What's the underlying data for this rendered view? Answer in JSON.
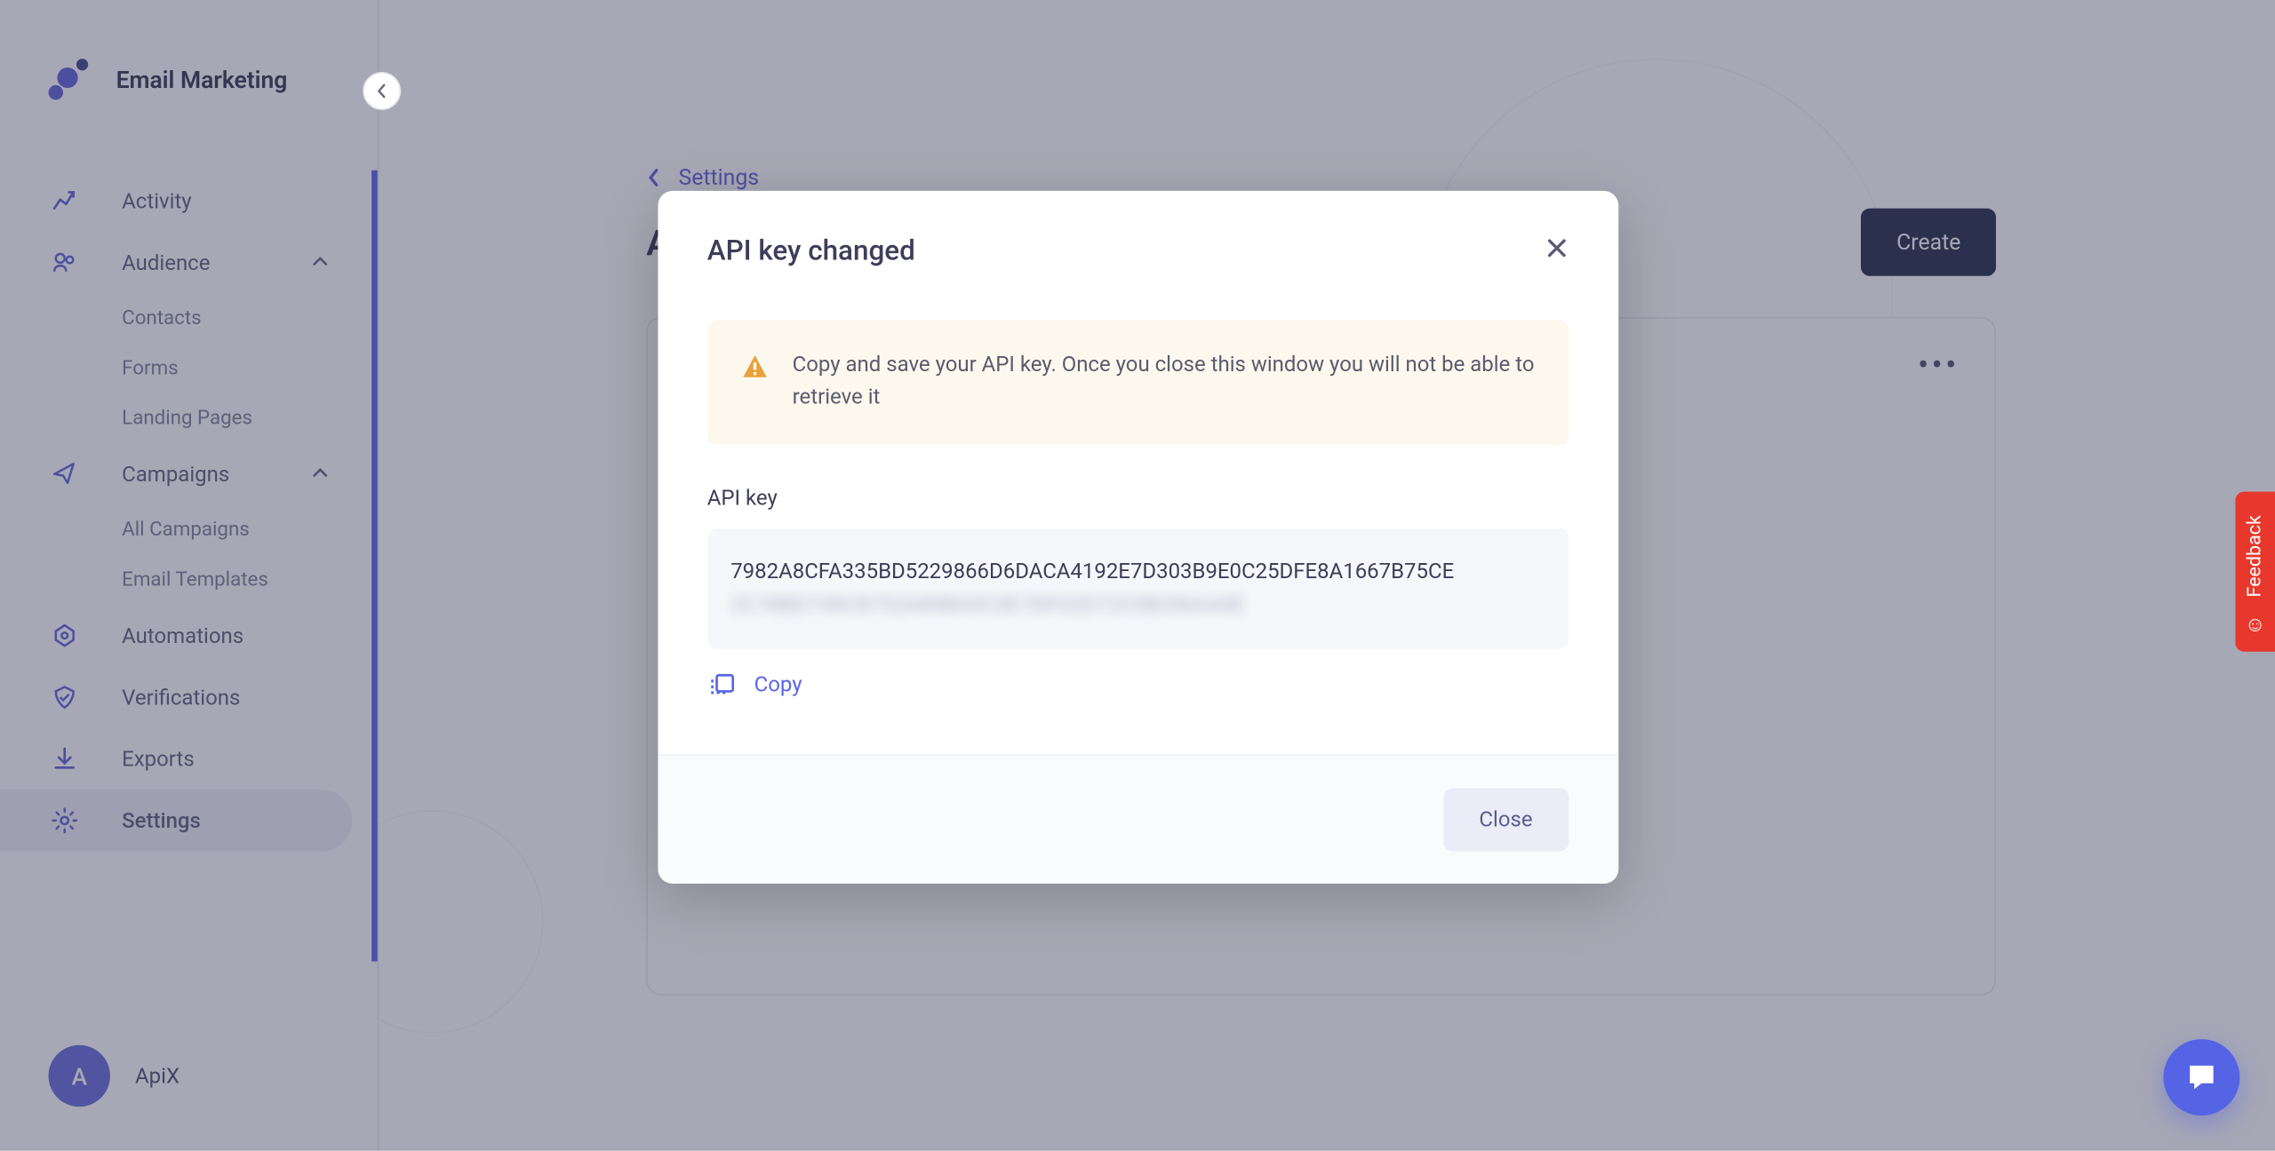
{
  "app": {
    "title": "Email Marketing"
  },
  "sidebar": {
    "activity": "Activity",
    "audience": "Audience",
    "contacts": "Contacts",
    "forms": "Forms",
    "landing_pages": "Landing Pages",
    "campaigns": "Campaigns",
    "all_campaigns": "All Campaigns",
    "email_templates": "Email Templates",
    "automations": "Automations",
    "verifications": "Verifications",
    "exports": "Exports",
    "settings": "Settings"
  },
  "user": {
    "initial": "A",
    "name": "ApiX"
  },
  "breadcrumb": {
    "label": "Settings"
  },
  "page": {
    "title": "A"
  },
  "header": {
    "create_label": "Create"
  },
  "modal": {
    "title": "API key changed",
    "alert": "Copy and save your API key. Once you close this window you will not be able to retrieve it",
    "field_label": "API key",
    "key_visible": "7982A8CFA335BD5229866D6DACA4192E7D303B9E0C25DFE8A1667B75CE",
    "key_hidden": "2C78BD749C8752A89BA9C0E7DF02D72C0B206A44E",
    "copy_label": "Copy",
    "close_label": "Close"
  },
  "feedback": {
    "label": "Feedback"
  },
  "card_menu": "•••"
}
